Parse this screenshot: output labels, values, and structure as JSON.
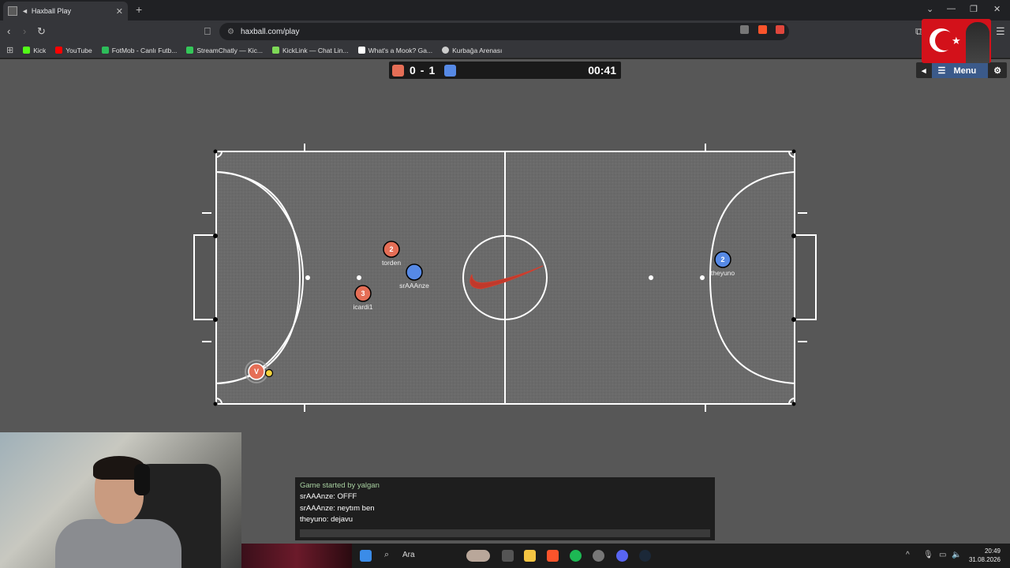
{
  "browser": {
    "tab_title": "Haxball Play",
    "url": "haxball.com/play",
    "bookmarks": [
      {
        "label": "Kick",
        "color": "#53fc18"
      },
      {
        "label": "YouTube",
        "color": "#ff0000"
      },
      {
        "label": "FotMob - Canlı Futb...",
        "color": "#2dbd5a"
      },
      {
        "label": "StreamChatly — Kic...",
        "color": "#34c759"
      },
      {
        "label": "KickLink — Chat Lin...",
        "color": "#7ed957"
      },
      {
        "label": "What's a Mook? Ga...",
        "color": "#ffffff"
      },
      {
        "label": "Kurbağa Arenası",
        "color": "#cccccc"
      }
    ]
  },
  "scoreboard": {
    "red_score": "0",
    "separator": "-",
    "blue_score": "1",
    "timer": "00:41",
    "red_color": "#e56e56",
    "blue_color": "#5689e5",
    "menu_label": "Menu"
  },
  "players": [
    {
      "team": "red",
      "number": "2",
      "name": "torden"
    },
    {
      "team": "blue",
      "number": "",
      "name": "srAAAnze"
    },
    {
      "team": "red",
      "number": "3",
      "name": "icardi1"
    },
    {
      "team": "blue",
      "number": "2",
      "name": "theyuno"
    },
    {
      "team": "red",
      "number": "V",
      "name": ""
    }
  ],
  "chat": {
    "messages": [
      {
        "text": "Game started by yalgan",
        "type": "system"
      },
      {
        "text": "srAAAnze: OFFF",
        "type": "user"
      },
      {
        "text": "srAAAnze: neytım ben",
        "type": "user"
      },
      {
        "text": "theyuno: dejavu",
        "type": "user"
      }
    ]
  },
  "taskbar": {
    "search_label": "Ara",
    "time": "20:49",
    "date": "31.08.2026"
  }
}
